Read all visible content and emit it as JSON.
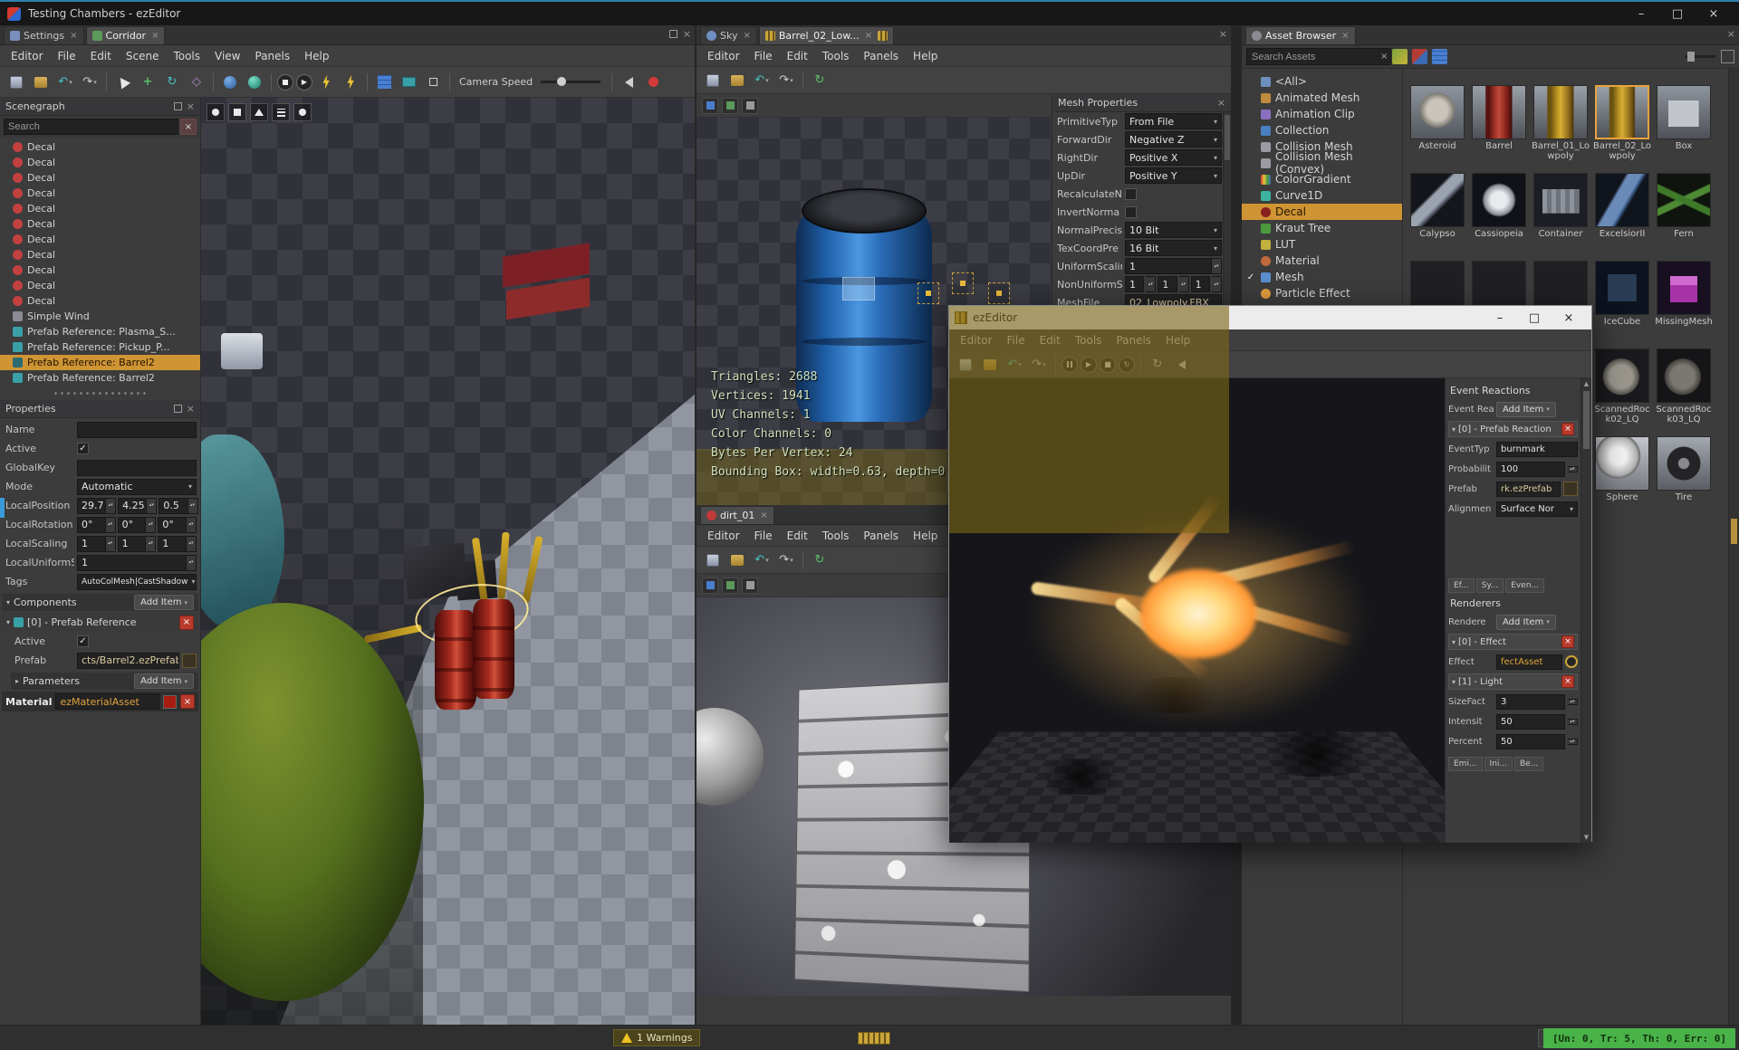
{
  "app": {
    "title": "Testing Chambers - ezEditor",
    "statusbar": {
      "warnings": "1 Warnings",
      "stats": "[Un: 0, Tr: 5, Th: 0, Err: 0]"
    },
    "colors": {
      "selection_orange": "#cf9433",
      "status_green": "#49b249",
      "error_red": "#b93a2c"
    }
  },
  "scene_window": {
    "tabs": [
      "Settings",
      "Corridor"
    ],
    "menus": [
      "Editor",
      "File",
      "Edit",
      "Scene",
      "Tools",
      "View",
      "Panels",
      "Help"
    ],
    "toolbar": {
      "camera_speed_label": "Camera Speed"
    },
    "scenegraph": {
      "title": "Scenegraph",
      "search_placeholder": "Search",
      "items": [
        "Decal",
        "Decal",
        "Decal",
        "Decal",
        "Decal",
        "Decal",
        "Decal",
        "Decal",
        "Decal",
        "Decal",
        "Decal",
        "Simple Wind",
        "Prefab Reference: Plasma_S...",
        "Prefab Reference: Pickup_P...",
        "Prefab Reference: Barrel2",
        "Prefab Reference: Barrel2"
      ]
    },
    "properties": {
      "title": "Properties",
      "name": {
        "label": "Name",
        "value": ""
      },
      "active": {
        "label": "Active"
      },
      "globalkey": {
        "label": "GlobalKey",
        "value": ""
      },
      "mode": {
        "label": "Mode",
        "value": "Automatic"
      },
      "localposition": {
        "label": "LocalPosition",
        "x": "29.7",
        "y": "4.25",
        "z": "0.5"
      },
      "localrotation": {
        "label": "LocalRotation",
        "x": "0°",
        "y": "0°",
        "z": "0°"
      },
      "localscaling": {
        "label": "LocalScaling",
        "x": "1",
        "y": "1",
        "z": "1"
      },
      "localuniformscaling": {
        "label": "LocalUniformSc",
        "value": "1"
      },
      "tags": {
        "label": "Tags",
        "value": "AutoColMesh|CastShadow"
      },
      "components": {
        "label": "Components",
        "add_item": "Add Item"
      },
      "component0": {
        "header": "[0] - Prefab Reference",
        "active_label": "Active",
        "prefab_label": "Prefab",
        "prefab_value": "cts/Barrel2.ezPrefab",
        "parameters_label": "Parameters",
        "add_item": "Add Item"
      },
      "material": {
        "label": "Material",
        "value": "ezMaterialAsset"
      }
    }
  },
  "mesh_window": {
    "tabs": [
      "Sky",
      "Barrel_02_Low..."
    ],
    "menus": [
      "Editor",
      "File",
      "Edit",
      "Tools",
      "Panels",
      "Help"
    ],
    "viewport_stats": [
      "Triangles: 2688",
      "Vertices: 1941",
      "UV Channels: 1",
      "Color Channels: 0",
      "Bytes Per Vertex: 24",
      "Bounding Box: width=0.63, depth=0"
    ],
    "mesh_properties": {
      "title": "Mesh Properties",
      "primitivetype": {
        "label": "PrimitiveTyp",
        "value": "From File"
      },
      "forwarddir": {
        "label": "ForwardDir",
        "value": "Negative Z"
      },
      "rightdir": {
        "label": "RightDir",
        "value": "Positive X"
      },
      "updir": {
        "label": "UpDir",
        "value": "Positive Y"
      },
      "recalculatenormals": {
        "label": "RecalculateN"
      },
      "invertnormals": {
        "label": "InvertNorma"
      },
      "normalprecision": {
        "label": "NormalPrecis",
        "value": "10 Bit"
      },
      "texcoordprecision": {
        "label": "TexCoordPre",
        "value": "16 Bit"
      },
      "uniformscaling": {
        "label": "UniformScalin",
        "value": "1"
      },
      "nonuniformscaling": {
        "label": "NonUniformS",
        "x": "1",
        "y": "1",
        "z": "1"
      },
      "meshfile": {
        "label": "MeshFile",
        "value": "02_Lowpoly.FBX"
      }
    }
  },
  "texture_window": {
    "tabs": [
      "dirt_01"
    ],
    "menus": [
      "Editor",
      "File",
      "Edit",
      "Tools",
      "Panels",
      "Help"
    ]
  },
  "particle_window": {
    "title": "ezEditor",
    "menus": [
      "Editor",
      "File",
      "Edit",
      "Tools",
      "Panels",
      "Help"
    ],
    "event_reactions": {
      "title": "Event Reactions",
      "list_label": "Event Reac",
      "add_item": "Add Item",
      "item0": {
        "header": "[0] - Prefab Reaction",
        "eventtype": {
          "label": "EventTyp",
          "value": "burnmark"
        },
        "probability": {
          "label": "Probabilit",
          "value": "100"
        },
        "prefab": {
          "label": "Prefab",
          "value": "rk.ezPrefab"
        },
        "alignment": {
          "label": "Alignmen",
          "value": "Surface Nor"
        }
      },
      "tabs": [
        "Ef...",
        "Sy...",
        "Even..."
      ]
    },
    "renderers": {
      "title": "Renderers",
      "list_label": "Rendere",
      "add_item": "Add Item",
      "item0": {
        "header": "[0] - Effect",
        "effect_label": "Effect",
        "effect_value": "fectAsset"
      },
      "item1": {
        "header": "[1] - Light",
        "sizefactor": {
          "label": "SizeFact",
          "value": "3"
        },
        "intensity": {
          "label": "Intensit",
          "value": "50"
        },
        "percentage": {
          "label": "Percent",
          "value": "50"
        }
      },
      "tabs": [
        "Emi...",
        "Ini...",
        "Be..."
      ]
    }
  },
  "asset_browser": {
    "tab": "Asset Browser",
    "search_placeholder": "Search Assets",
    "tree": [
      "<All>",
      "Animated Mesh",
      "Animation Clip",
      "Collection",
      "Collision Mesh",
      "Collision Mesh (Convex)",
      "ColorGradient",
      "Curve1D",
      "Decal",
      "Kraut Tree",
      "LUT",
      "Material",
      "Mesh",
      "Particle Effect"
    ],
    "grid": [
      "Asteroid",
      "Barrel",
      "Barrel_01_Lowpoly",
      "Barrel_02_Lowpoly",
      "Box",
      "Calypso",
      "Cassiopeia",
      "Container",
      "ExcelsiorII",
      "Fern",
      "IceCube",
      "MissingMesh",
      "ScannedRock02_LQ",
      "ScannedRock03_LQ",
      "Sphere",
      "Tire"
    ]
  }
}
